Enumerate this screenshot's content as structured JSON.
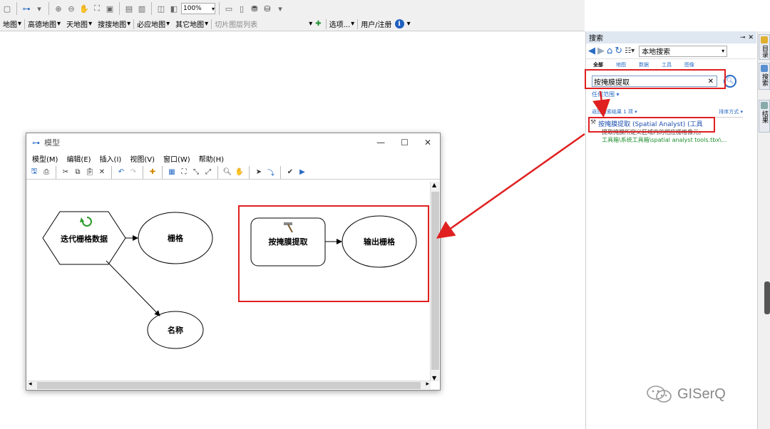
{
  "toolbar": {
    "zoom_value": "100%"
  },
  "map_bar": {
    "items": [
      {
        "label": "地图"
      },
      {
        "label": "高德地图"
      },
      {
        "label": "天地图"
      },
      {
        "label": "搜搜地图"
      },
      {
        "label": "必应地图"
      },
      {
        "label": "其它地图"
      }
    ],
    "tile_layer_placeholder": "切片图层列表",
    "options_label": "选项...",
    "user_label": "用户/注册"
  },
  "search_panel": {
    "title": "搜索",
    "scope": "本地搜索",
    "tabs": [
      "全部",
      "地图",
      "数据",
      "工具",
      "图像"
    ],
    "query": "按掩膜提取",
    "any_extent": "任何范围",
    "results_count": "返回搜索结果 1 项",
    "sort_label": "排序方式",
    "result": {
      "title": "按掩膜提取 (Spatial Analyst) (工具",
      "description": "提取掩膜所定义区域内的相应栅格像元。",
      "path": "工具箱\\系统工具箱\\spatial analyst tools.tbx\\..."
    }
  },
  "side_tabs": [
    "目录",
    "搜索",
    "结果"
  ],
  "model_window": {
    "title": "模型",
    "menu": [
      "模型(M)",
      "编辑(E)",
      "插入(I)",
      "视图(V)",
      "窗口(W)",
      "帮助(H)"
    ],
    "nodes": {
      "iterator": "迭代栅格数据",
      "raster": "栅格",
      "name": "名称",
      "tool": "按掩膜提取",
      "output": "输出栅格"
    }
  },
  "watermark": "GISerQ",
  "colors": {
    "highlight_red": "#e02020",
    "link_blue": "#1f4fb0",
    "path_green": "#1d8f2c"
  }
}
